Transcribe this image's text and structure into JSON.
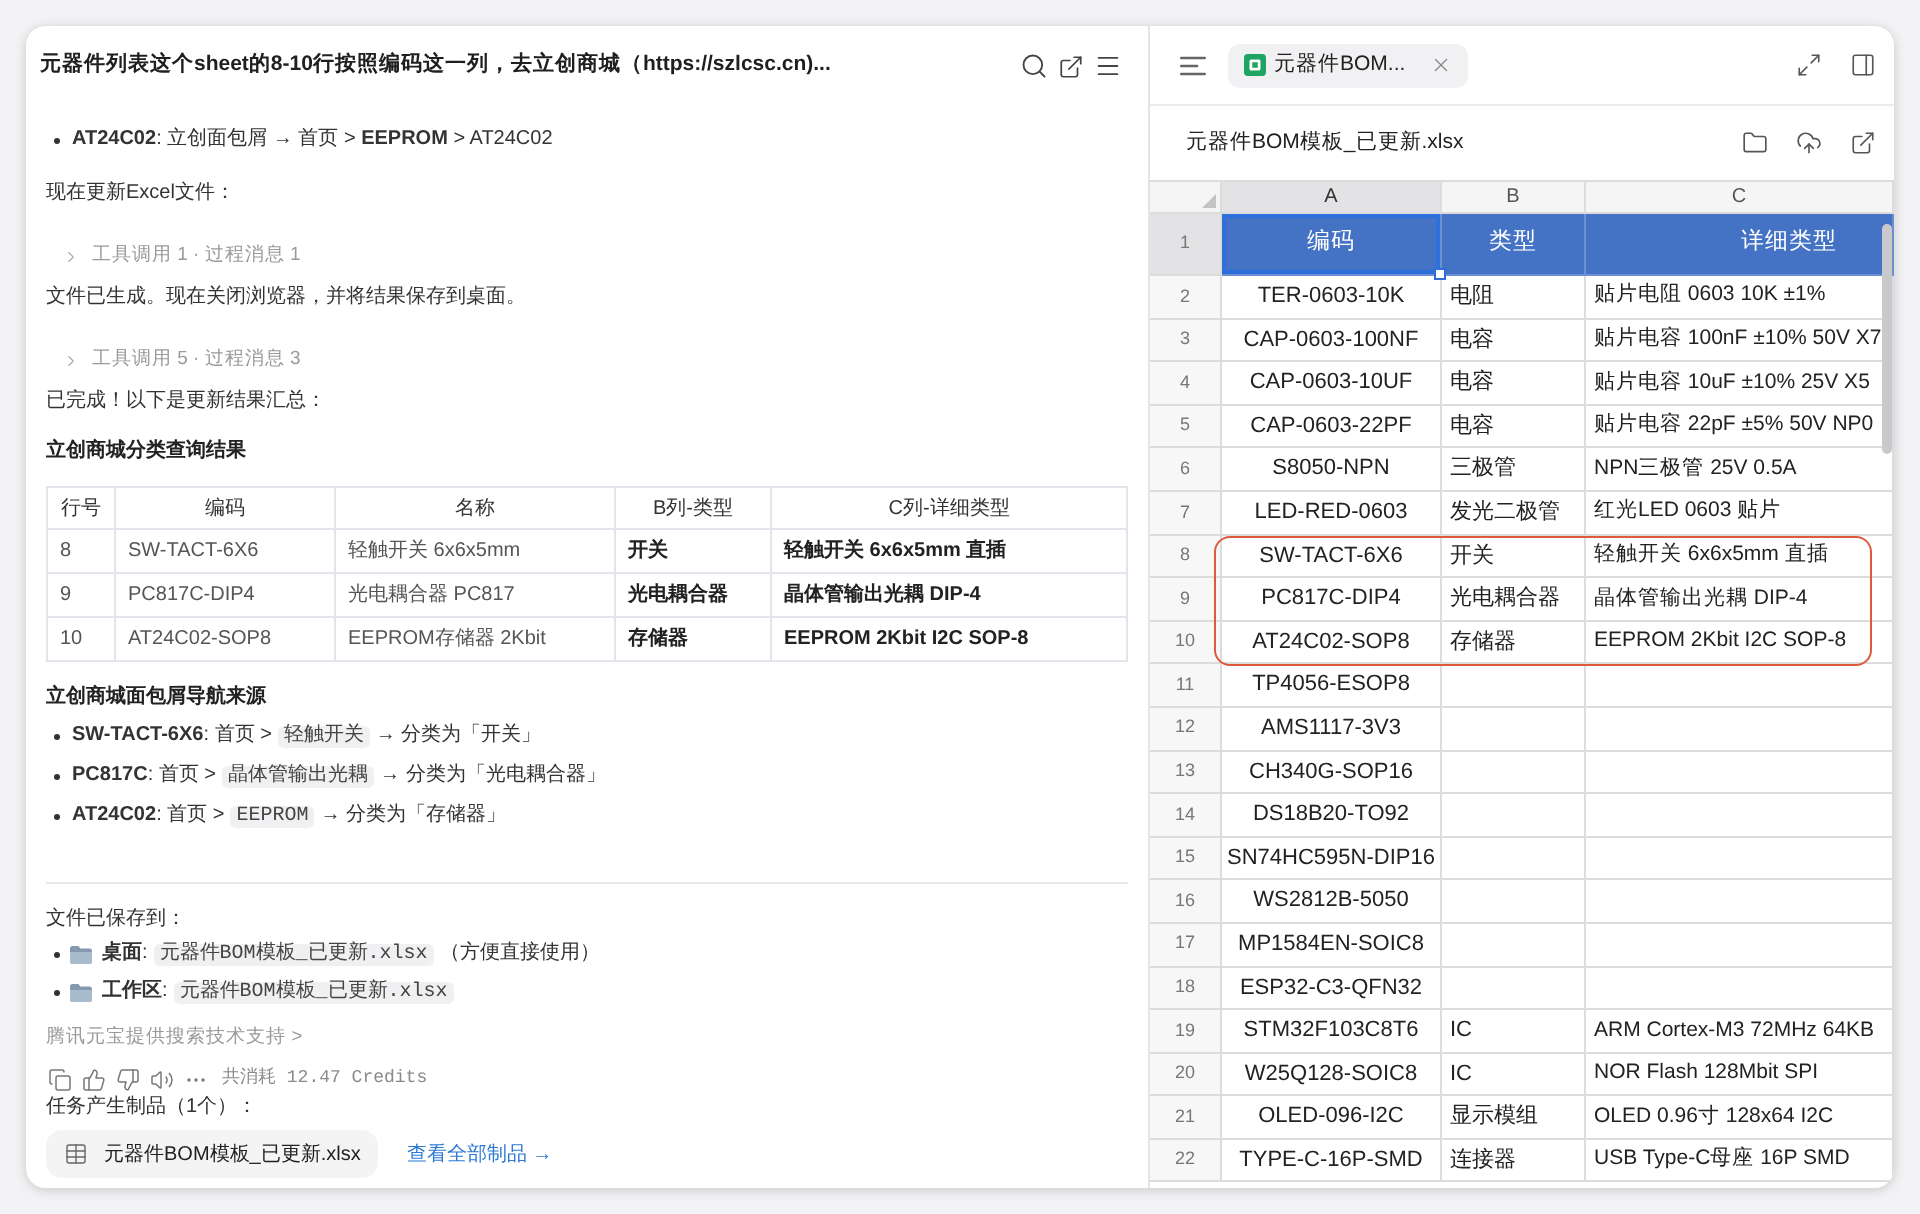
{
  "chat": {
    "title": "元器件列表这个sheet的8-10行按照编码这一列，去立创商城（https://szlcsc.cn)...",
    "blocks": [
      {
        "kind": "bullets",
        "items": [
          {
            "parts": [
              {
                "kind": "text",
                "text": "**AT24C02**: 立创面包屑 → 首页 > **EEPROM** > AT24C02"
              }
            ]
          }
        ]
      },
      {
        "kind": "paragraph",
        "text": "现在更新Excel文件："
      },
      {
        "kind": "tool_step",
        "text": "工具调用 1 · 过程消息 1",
        "expanded": false
      },
      {
        "kind": "paragraph",
        "text": "文件已生成。现在关闭浏览器，并将结果保存到桌面。"
      },
      {
        "kind": "tool_step",
        "text": "工具调用 5 · 过程消息 3",
        "expanded": false
      },
      {
        "kind": "paragraph",
        "text": "已完成！以下是更新结果汇总："
      },
      {
        "kind": "heading",
        "text": "立创商城分类查询结果"
      },
      {
        "kind": "table",
        "columns": [
          {
            "label": "行号",
            "bold": false
          },
          {
            "label": "编码",
            "bold": false
          },
          {
            "label": "名称",
            "bold": false
          },
          {
            "label": "B列-类型",
            "bold": true
          },
          {
            "label": "C列-详细类型",
            "bold": true
          }
        ],
        "rows": [
          [
            "8",
            "SW-TACT-6X6",
            "轻触开关 6x6x5mm",
            "开关",
            "轻触开关 6x6x5mm 直插"
          ],
          [
            "9",
            "PC817C-DIP4",
            "光电耦合器 PC817",
            "光电耦合器",
            "晶体管输出光耦 DIP-4"
          ],
          [
            "10",
            "AT24C02-SOP8",
            "EEPROM存储器 2Kbit",
            "存储器",
            "EEPROM 2Kbit I2C SOP-8"
          ]
        ]
      },
      {
        "kind": "heading",
        "text": "立创商城面包屑导航来源"
      },
      {
        "kind": "bullets",
        "items": [
          {
            "parts": [
              {
                "kind": "text",
                "text": "**SW-TACT-6X6**: 首页 >"
              },
              {
                "kind": "code",
                "text": "轻触开关"
              },
              {
                "kind": "text",
                "text": "→ 分类为「开关」"
              }
            ]
          },
          {
            "parts": [
              {
                "kind": "text",
                "text": "**PC817C**: 首页 >"
              },
              {
                "kind": "code",
                "text": "晶体管输出光耦"
              },
              {
                "kind": "text",
                "text": "→ 分类为「光电耦合器」"
              }
            ]
          },
          {
            "parts": [
              {
                "kind": "text",
                "text": "**AT24C02**: 首页 >"
              },
              {
                "kind": "code",
                "text": "EEPROM"
              },
              {
                "kind": "text",
                "text": "→ 分类为「存储器」"
              }
            ]
          }
        ]
      }
    ],
    "saved": {
      "label": "文件已保存到：",
      "items": [
        {
          "parts": [
            {
              "kind": "text",
              "text": "**桌面**:"
            },
            {
              "kind": "code",
              "text": "元器件BOM模板_已更新.xlsx"
            },
            {
              "kind": "text",
              "text": "（方便直接使用）"
            }
          ]
        },
        {
          "parts": [
            {
              "kind": "text",
              "text": "**工作区**:"
            },
            {
              "kind": "code",
              "text": "元器件BOM模板_已更新.xlsx"
            }
          ]
        }
      ]
    },
    "search_credit": "腾讯元宝提供搜索技术支持 >",
    "usage": "共消耗 12.47 Credits",
    "artifacts": {
      "label": "任务产生制品（1个）：",
      "files": [
        {
          "name": "元器件BOM模板_已更新.xlsx"
        }
      ],
      "view_all": "查看全部制品 →"
    }
  },
  "viewer": {
    "tabs": [
      {
        "label": "元器件BOM...",
        "selected": true
      }
    ],
    "file_name": "元器件BOM模板_已更新.xlsx",
    "sheet": {
      "columns": [
        {
          "label": "A",
          "selected": true
        },
        {
          "label": "B",
          "selected": false
        },
        {
          "label": "C",
          "selected": false
        }
      ],
      "rows": [
        {
          "number": "1",
          "kind": "header",
          "selected": true,
          "highlighted": false,
          "cells": [
            "编码",
            "类型",
            "详细类型"
          ]
        },
        {
          "number": "2",
          "kind": "data",
          "selected": false,
          "highlighted": false,
          "cells": [
            "TER-0603-10K",
            "电阻",
            "贴片电阻 0603 10K ±1%"
          ]
        },
        {
          "number": "3",
          "kind": "data",
          "selected": false,
          "highlighted": false,
          "cells": [
            "CAP-0603-100NF",
            "电容",
            "贴片电容 100nF ±10% 50V X7"
          ]
        },
        {
          "number": "4",
          "kind": "data",
          "selected": false,
          "highlighted": false,
          "cells": [
            "CAP-0603-10UF",
            "电容",
            "贴片电容 10uF ±10% 25V X5"
          ]
        },
        {
          "number": "5",
          "kind": "data",
          "selected": false,
          "highlighted": false,
          "cells": [
            "CAP-0603-22PF",
            "电容",
            "贴片电容 22pF ±5% 50V NP0"
          ]
        },
        {
          "number": "6",
          "kind": "data",
          "selected": false,
          "highlighted": false,
          "cells": [
            "S8050-NPN",
            "三极管",
            "NPN三极管 25V 0.5A"
          ]
        },
        {
          "number": "7",
          "kind": "data",
          "selected": false,
          "highlighted": false,
          "cells": [
            "LED-RED-0603",
            "发光二极管",
            "红光LED 0603 贴片"
          ]
        },
        {
          "number": "8",
          "kind": "data",
          "selected": false,
          "highlighted": true,
          "cells": [
            "SW-TACT-6X6",
            "开关",
            "轻触开关 6x6x5mm 直插"
          ]
        },
        {
          "number": "9",
          "kind": "data",
          "selected": false,
          "highlighted": true,
          "cells": [
            "PC817C-DIP4",
            "光电耦合器",
            "晶体管输出光耦 DIP-4"
          ]
        },
        {
          "number": "10",
          "kind": "data",
          "selected": false,
          "highlighted": true,
          "cells": [
            "AT24C02-SOP8",
            "存储器",
            "EEPROM 2Kbit I2C SOP-8"
          ]
        },
        {
          "number": "11",
          "kind": "data",
          "selected": false,
          "highlighted": false,
          "cells": [
            "TP4056-ESOP8"
          ]
        },
        {
          "number": "12",
          "kind": "data",
          "selected": false,
          "highlighted": false,
          "cells": [
            "AMS1117-3V3"
          ]
        },
        {
          "number": "13",
          "kind": "data",
          "selected": false,
          "highlighted": false,
          "cells": [
            "CH340G-SOP16"
          ]
        },
        {
          "number": "14",
          "kind": "data",
          "selected": false,
          "highlighted": false,
          "cells": [
            "DS18B20-TO92"
          ]
        },
        {
          "number": "15",
          "kind": "data",
          "selected": false,
          "highlighted": false,
          "cells": [
            "SN74HC595N-DIP16"
          ]
        },
        {
          "number": "16",
          "kind": "data",
          "selected": false,
          "highlighted": false,
          "cells": [
            "WS2812B-5050"
          ]
        },
        {
          "number": "17",
          "kind": "data",
          "selected": false,
          "highlighted": false,
          "cells": [
            "MP1584EN-SOIC8"
          ]
        },
        {
          "number": "18",
          "kind": "data",
          "selected": false,
          "highlighted": false,
          "cells": [
            "ESP32-C3-QFN32"
          ]
        },
        {
          "number": "19",
          "kind": "data",
          "selected": false,
          "highlighted": false,
          "cells": [
            "STM32F103C8T6",
            "IC",
            "ARM Cortex-M3 72MHz 64KB"
          ]
        },
        {
          "number": "20",
          "kind": "data",
          "selected": false,
          "highlighted": false,
          "cells": [
            "W25Q128-SOIC8",
            "IC",
            "NOR Flash 128Mbit SPI"
          ]
        },
        {
          "number": "21",
          "kind": "data",
          "selected": false,
          "highlighted": false,
          "cells": [
            "OLED-096-I2C",
            "显示模组",
            "OLED 0.96寸 128x64 I2C"
          ]
        },
        {
          "number": "22",
          "kind": "data",
          "selected": false,
          "highlighted": false,
          "cells": [
            "TYPE-C-16P-SMD",
            "连接器",
            "USB Type-C母座 16P SMD"
          ]
        }
      ]
    }
  }
}
